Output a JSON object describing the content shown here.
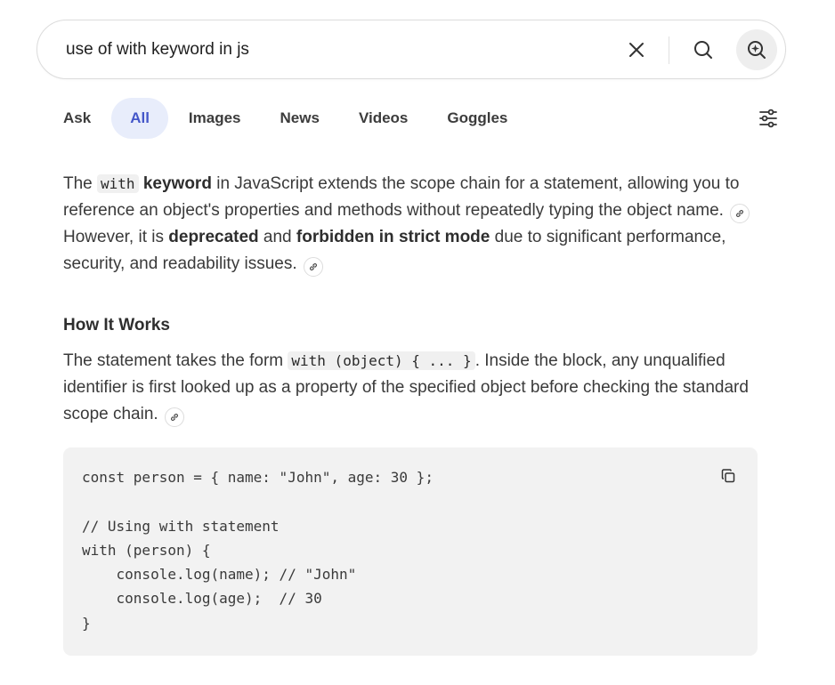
{
  "search": {
    "query": "use of with keyword in js",
    "icons": {
      "clear": "close-icon",
      "search": "search-icon",
      "assistant": "ai-search-icon"
    }
  },
  "tabs": [
    {
      "label": "Ask",
      "active": false
    },
    {
      "label": "All",
      "active": true
    },
    {
      "label": "Images",
      "active": false
    },
    {
      "label": "News",
      "active": false
    },
    {
      "label": "Videos",
      "active": false
    },
    {
      "label": "Goggles",
      "active": false
    }
  ],
  "filter_icon": "sliders-icon",
  "answer": {
    "intro": {
      "t1": "The ",
      "code1": "with",
      "b1": "keyword",
      "t2": " in JavaScript extends the scope chain for a statement, allowing you to reference an object's properties and methods without repeatedly typing the object name. ",
      "t3": " However, it is ",
      "b2": "deprecated",
      "t4": " and ",
      "b3": "forbidden in strict mode",
      "t5": " due to significant performance, security, and readability issues. "
    },
    "heading": "How It Works",
    "how": {
      "t1": "The statement takes the form ",
      "code1": "with (object) { ... }",
      "t2": ". Inside the block, any unqualified identifier is first looked up as a property of the specified object before checking the standard scope chain. "
    },
    "code": "const person = { name: \"John\", age: 30 };\n\n// Using with statement\nwith (person) {\n    console.log(name); // \"John\"\n    console.log(age);  // 30\n}"
  },
  "colors": {
    "active_tab_bg": "#e8edfb",
    "active_tab_text": "#4457c9",
    "code_bg": "#f2f2f2"
  }
}
